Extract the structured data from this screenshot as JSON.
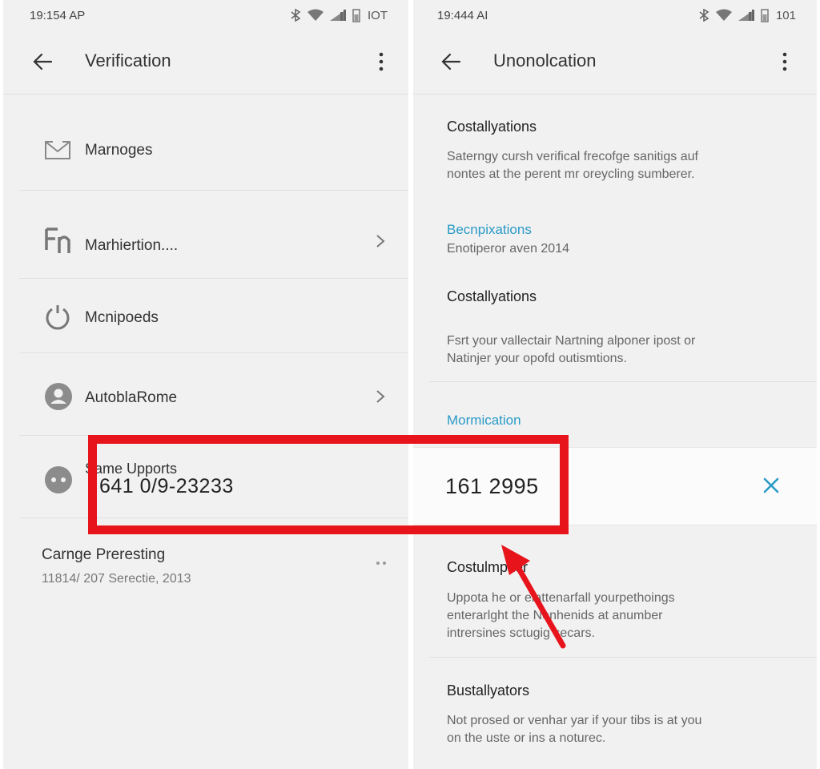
{
  "left_screen": {
    "status": {
      "time": "19:154 AP",
      "battery_text": "IOT"
    },
    "title": "Verification",
    "items": [
      {
        "label": "Marnoges",
        "icon": "mail-icon",
        "chevron": false
      },
      {
        "label": "Marhiertion....",
        "icon": "fn-logo-icon",
        "chevron": true
      },
      {
        "label": "Mcnipoeds",
        "icon": "power-icon",
        "chevron": false
      },
      {
        "label": "AutoblaRome",
        "icon": "person-icon",
        "chevron": true
      },
      {
        "label": "Same Upports",
        "icon": "face-icon",
        "chevron": false,
        "number": "641 0/9-23233"
      }
    ],
    "footer": {
      "title": "Carnge Preresting",
      "subtitle": "11814/ 207 Serectie, 2013",
      "more_icon": "dots-horizontal-icon"
    }
  },
  "right_screen": {
    "status": {
      "time": "19:444 AI",
      "battery_text": "101"
    },
    "title": "Unonolcation",
    "sections": [
      {
        "title": "Costallyations",
        "body_line1": "Saterngy cursh verifical frecofge sanitigs auf",
        "body_line2": "nontes at the perent mr oreycling sumberer."
      },
      {
        "link": "Becnpixations",
        "body_line1": "Enotiperor aven 2014"
      },
      {
        "title": "Costallyations",
        "body_line1": "Fsrt your vallectair Nartning alponer ipost or",
        "body_line2": "Natinjer your opofd outismtions."
      },
      {
        "link": "Mormication"
      }
    ],
    "code": {
      "value": "161 2995",
      "clear_icon": "close-icon"
    },
    "sections_after": [
      {
        "title": "Costulmpiter",
        "body_line1": "Uppota he or elattenarfall yourpethoings",
        "body_line2": "enterarlght the Nenhenids at anumber",
        "body_line3": "intrersines sctugig secars."
      },
      {
        "title": "Bustallyators",
        "body_line1": "Not prosed or venhar yar if your tibs is at you",
        "body_line2": "on the uste or ins a noturec."
      }
    ]
  },
  "annotation": {
    "box_color": "#e8141c",
    "arrow_color": "#e8141c"
  },
  "colors": {
    "accent_blue": "#2a9bc7",
    "background": "#f1f1f1"
  }
}
